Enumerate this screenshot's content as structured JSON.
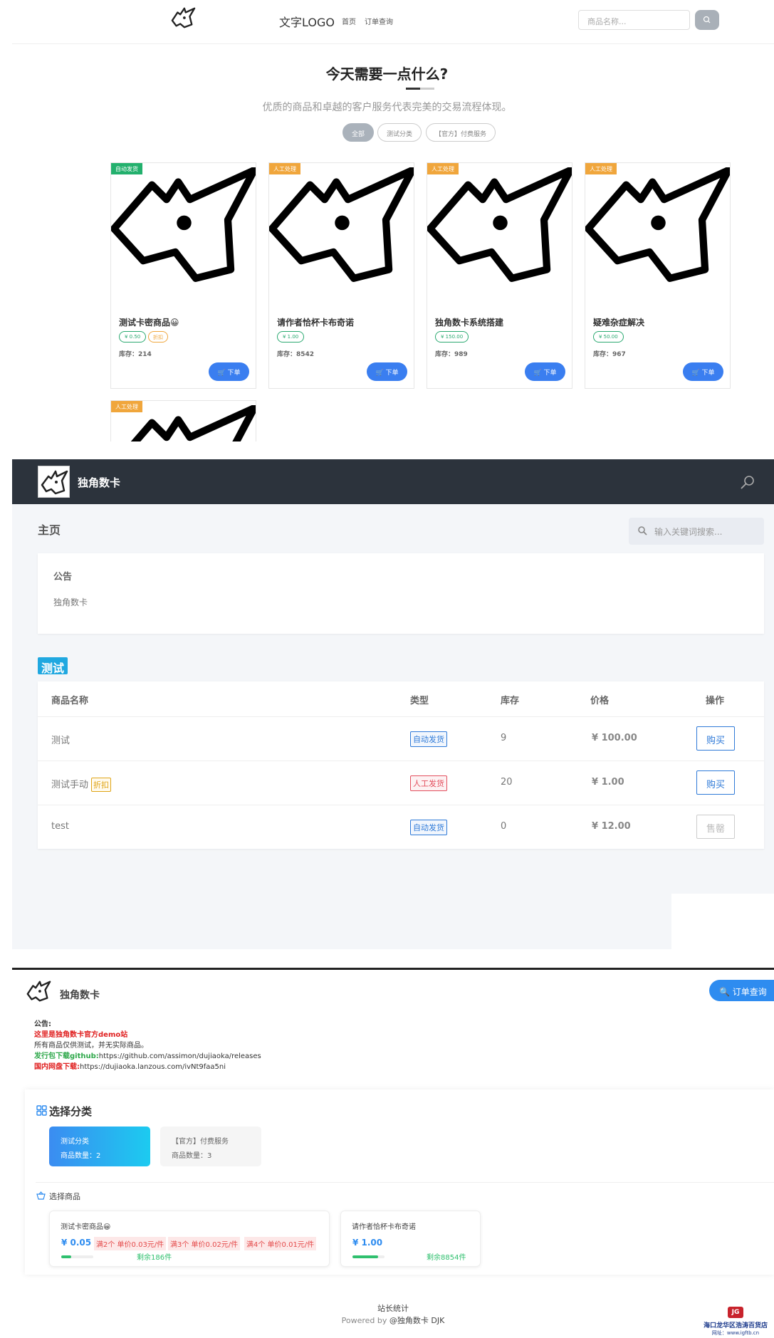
{
  "s1": {
    "brand": "文字LOGO",
    "nav": [
      "首页",
      "订单查询"
    ],
    "search_placeholder": "商品名称...",
    "title": "今天需要一点什么?",
    "subtitle": "优质的商品和卓越的客户服务代表完美的交易流程体现。",
    "categories": [
      "全部",
      "测试分类",
      "【官方】付费服务"
    ],
    "cards": [
      {
        "badge": "自动发货",
        "badge_color": "#23b06d",
        "name": "测试卡密商品😀",
        "price": "¥ 0.50",
        "discount": "折扣",
        "stock": "库存：214",
        "buy": "下单"
      },
      {
        "badge": "人工处理",
        "badge_color": "#f0a63c",
        "name": "请作者恰杯卡布奇诺",
        "price": "¥ 1.00",
        "stock": "库存：8542",
        "buy": "下单"
      },
      {
        "badge": "人工处理",
        "badge_color": "#f0a63c",
        "name": "独角数卡系统搭建",
        "price": "¥ 150.00",
        "stock": "库存：989",
        "buy": "下单"
      },
      {
        "badge": "人工处理",
        "badge_color": "#f0a63c",
        "name": "疑难杂症解决",
        "price": "¥ 50.00",
        "stock": "库存：967",
        "buy": "下单"
      },
      {
        "badge": "人工处理",
        "badge_color": "#f0a63c"
      }
    ]
  },
  "s2": {
    "brand": "独角数卡",
    "page_title": "主页",
    "search_placeholder": "输入关键词搜索...",
    "notice_title": "公告",
    "notice_body": "独角数卡",
    "group": "测试",
    "headers": [
      "商品名称",
      "类型",
      "库存",
      "价格",
      "操作"
    ],
    "rows": [
      {
        "name": "测试",
        "tag": "自动发货",
        "stock": "9",
        "price": "¥ 100.00",
        "action": "购买"
      },
      {
        "name": "测试手动",
        "discount": "折扣",
        "tag": "人工发货",
        "stock": "20",
        "price": "¥ 1.00",
        "action": "购买"
      },
      {
        "name": "test",
        "tag": "自动发货",
        "stock": "0",
        "price": "¥ 12.00",
        "action": "售罄"
      }
    ]
  },
  "s3": {
    "brand": "独角数卡",
    "query_btn": "订单查询",
    "notice_label": "公告:",
    "notice_line1": "这里是独角数卡官方demo站",
    "notice_line2": "所有商品仅供测试，并无实际商品。",
    "notice_line3_label": "发行包下载github:",
    "notice_line3_value": "https://github.com/assimon/dujiaoka/releases",
    "notice_line4_label": "国内网盘下载:",
    "notice_line4_value": "https://dujiaoka.lanzous.com/ivNt9faa5ni",
    "cat_title": "选择分类",
    "cats": [
      {
        "name": "测试分类",
        "count": "商品数量：2"
      },
      {
        "name": "【官方】付费服务",
        "count": "商品数量：3"
      }
    ],
    "prod_title": "选择商品",
    "products": [
      {
        "name": "测试卡密商品😀",
        "price": "¥ 0.05",
        "tiers": [
          "满2个 单价0.03元/件",
          "满3个 单价0.02元/件",
          "满4个 单价0.01元/件"
        ],
        "left": "剩余186件",
        "progress": 0.3
      },
      {
        "name": "请作者恰杯卡布奇诺",
        "price": "¥ 1.00",
        "left": "剩余8854件",
        "progress": 0.8
      }
    ],
    "footer1": "站长统计",
    "footer2_prefix": "Powered by ",
    "footer2_link": "@独角数卡 DJK",
    "stamp_logo": "JG",
    "stamp_name": "海口龙华区浩涛百货店",
    "stamp_url": "网址：www.igftb.cn"
  }
}
